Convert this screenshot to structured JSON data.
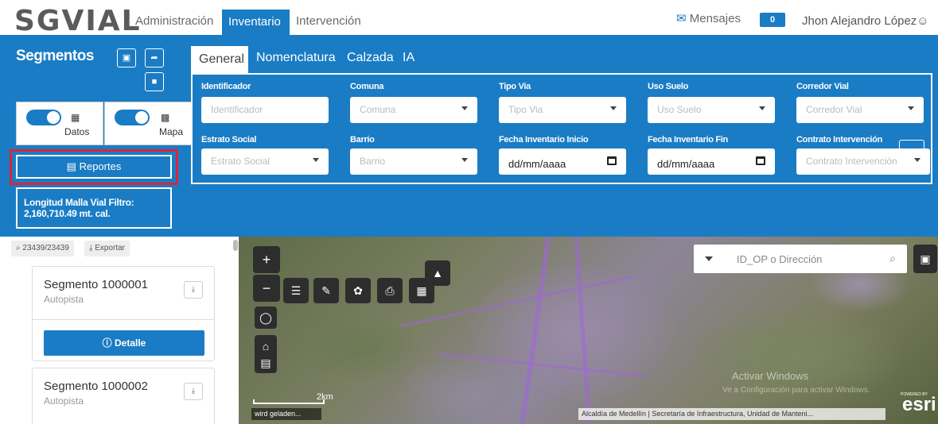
{
  "app": {
    "logo": "SGVIAL",
    "nav": {
      "admin": "Administración",
      "inventario": "Inventario",
      "intervencion": "Intervención"
    },
    "messages_label": "Mensajes",
    "messages_count": "0",
    "user_name": "Jhon Alejandro López"
  },
  "panel": {
    "title": "Segmentos",
    "toggle_datos": "Datos",
    "toggle_mapa": "Mapa",
    "reportes_label": "Reportes",
    "longitud_line1": "Longitud Malla Vial Filtro:",
    "longitud_line2": "2,160,710.49 mt. cal."
  },
  "filters": {
    "tabs": [
      "General",
      "Nomenclatura",
      "Calzada",
      "IA"
    ],
    "row1": [
      {
        "label": "Identificador",
        "placeholder": "Identificador",
        "type": "text"
      },
      {
        "label": "Comuna",
        "placeholder": "Comuna",
        "type": "select"
      },
      {
        "label": "Tipo Via",
        "placeholder": "Tipo Via",
        "type": "select"
      },
      {
        "label": "Uso Suelo",
        "placeholder": "Uso Suelo",
        "type": "select"
      },
      {
        "label": "Corredor Vial",
        "placeholder": "Corredor Vial",
        "type": "select"
      }
    ],
    "row2": [
      {
        "label": "Estrato Social",
        "placeholder": "Estrato Social",
        "type": "select"
      },
      {
        "label": "Barrio",
        "placeholder": "Barrio",
        "type": "select"
      },
      {
        "label": "Fecha Inventario Inicio",
        "placeholder": "dd/mm/aaaa",
        "type": "date"
      },
      {
        "label": "Fecha Inventario Fin",
        "placeholder": "dd/mm/aaaa",
        "type": "date"
      },
      {
        "label": "Contrato Intervención",
        "placeholder": "Contrato Intervención",
        "type": "select"
      }
    ]
  },
  "list": {
    "count": "23439/23439",
    "export_label": "Exportar",
    "items": [
      {
        "title": "Segmento 1000001",
        "subtitle": "Autopista",
        "detail_label": "Detalle"
      },
      {
        "title": "Segmento 1000002",
        "subtitle": "Autopista"
      }
    ]
  },
  "map": {
    "search_placeholder": "ID_OP o Dirección",
    "scale_label": "2km",
    "loading_text": "wird geladen...",
    "attribution": "Alcaldía de Medellín | Secretaría de Infraestructura, Unidad de Manteni...",
    "powered_by": "POWERED BY",
    "esri": "esri",
    "watermark_line1": "Activar Windows",
    "watermark_line2": "Ve a Configuración para activar Windows.",
    "icons": [
      "zoom-in-icon",
      "zoom-out-icon",
      "layers-icon",
      "measure-icon",
      "filter-icon",
      "print-icon",
      "basemap-icon",
      "chart-icon",
      "locate-icon",
      "home-icon",
      "legend-icon",
      "bookmark-icon"
    ]
  },
  "colors": {
    "primary": "#1a7cc4",
    "highlight": "#d9253b",
    "text_muted": "#6a6a6a"
  }
}
